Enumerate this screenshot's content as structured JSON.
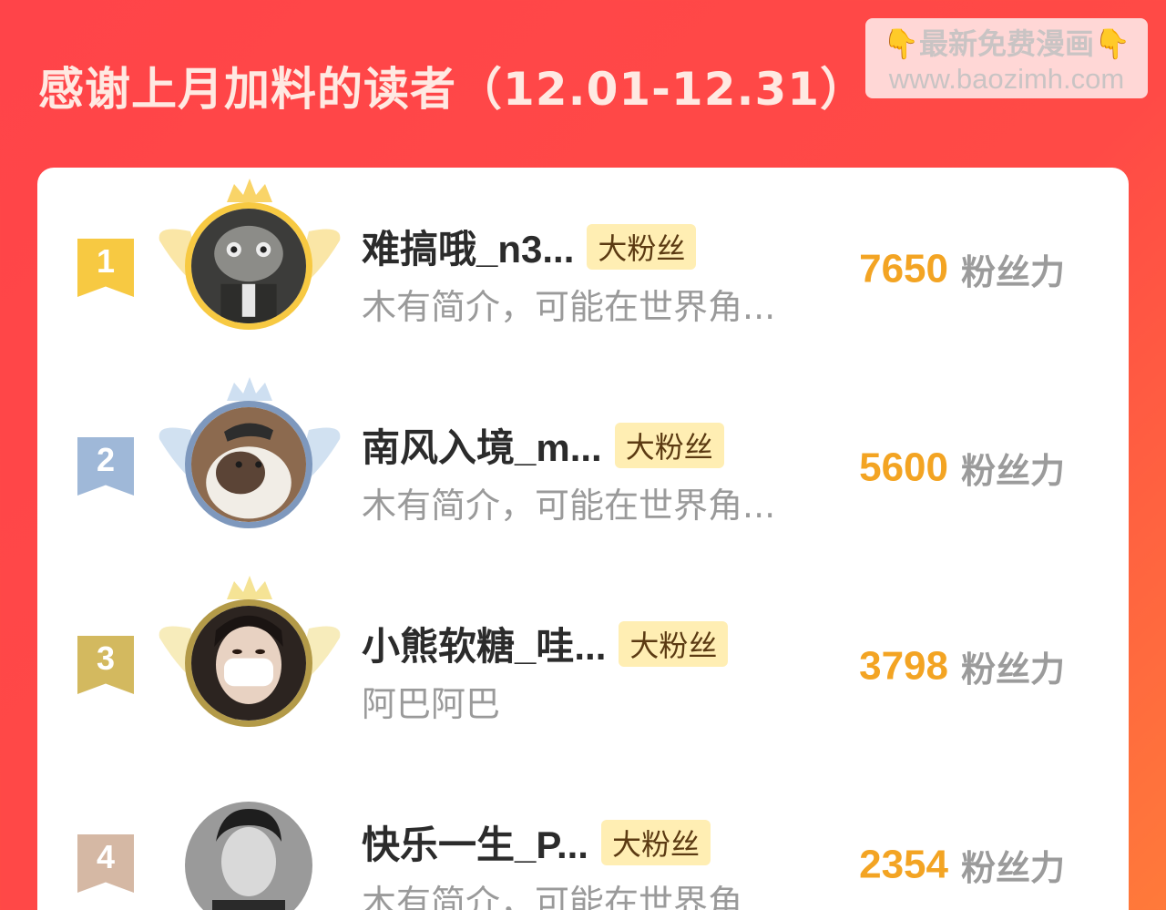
{
  "header": {
    "title": "感谢上月加料的读者（12.01-12.31）"
  },
  "watermark": {
    "line1": "最新免费漫画",
    "hand_left": "👇",
    "hand_right": "👇",
    "line2": "www.baozimh.com"
  },
  "colors": {
    "rank1": "#f7c942",
    "rank2": "#9fb8d8",
    "rank3": "#d3b95f",
    "rank4": "#d5b8a4",
    "score": "#f3a423",
    "badge_bg": "#ffeeb3"
  },
  "leaderboard": [
    {
      "rank": "1",
      "name": "难搞哦_n3...",
      "badge": "大粉丝",
      "bio": "木有简介，可能在世界角...",
      "score": "7650",
      "score_unit": "粉丝力",
      "avatar": "cartoon-cat-avatar"
    },
    {
      "rank": "2",
      "name": "南风入境_m...",
      "badge": "大粉丝",
      "bio": "木有简介，可能在世界角...",
      "score": "5600",
      "score_unit": "粉丝力",
      "avatar": "cat-with-hat-avatar"
    },
    {
      "rank": "3",
      "name": "小熊软糖_哇...",
      "badge": "大粉丝",
      "bio": "阿巴阿巴",
      "score": "3798",
      "score_unit": "粉丝力",
      "avatar": "masked-person-avatar"
    },
    {
      "rank": "4",
      "name": "快乐一生_P...",
      "badge": "大粉丝",
      "bio": "木有简介，可能在世界角...",
      "score": "2354",
      "score_unit": "粉丝力",
      "avatar": "man-portrait-avatar"
    }
  ]
}
